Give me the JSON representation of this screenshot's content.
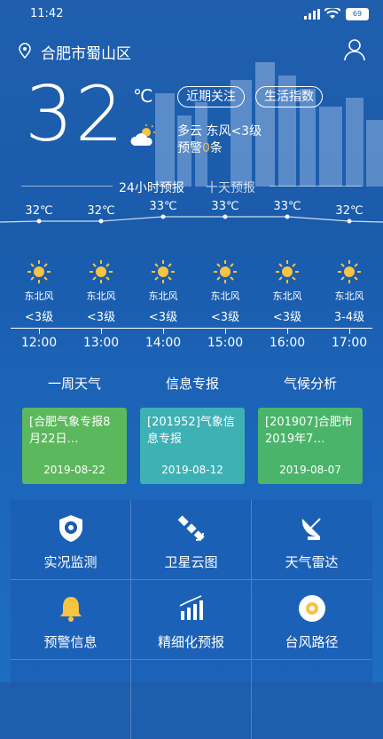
{
  "status_bar": {
    "time": "11:42",
    "battery": "69"
  },
  "header": {
    "location": "合肥市蜀山区"
  },
  "current": {
    "temperature": "32",
    "unit": "℃",
    "condition": "多云 东风<3级",
    "alert_label": "预警",
    "alert_count": "0",
    "alert_suffix": "条",
    "chips": [
      "近期关注",
      "生活指数"
    ]
  },
  "forecast_tabs": {
    "hourly": "24小时预报",
    "ten_day": "十天预报"
  },
  "hourly": [
    {
      "temp": "32℃",
      "wind": "东北风",
      "level": "<3级",
      "time": "12:00"
    },
    {
      "temp": "32℃",
      "wind": "东北风",
      "level": "<3级",
      "time": "13:00"
    },
    {
      "temp": "33℃",
      "wind": "东北风",
      "level": "<3级",
      "time": "14:00"
    },
    {
      "temp": "33℃",
      "wind": "东北风",
      "level": "<3级",
      "time": "15:00"
    },
    {
      "temp": "33℃",
      "wind": "东北风",
      "level": "<3级",
      "time": "16:00"
    },
    {
      "temp": "32℃",
      "wind": "东北风",
      "level": "3-4级",
      "time": "17:00"
    }
  ],
  "sections": {
    "titles": [
      "一周天气",
      "信息专报",
      "气候分析"
    ],
    "cards": [
      {
        "text": "[合肥气象专报8月22日…",
        "date": "2019-08-22"
      },
      {
        "text": "[201952]气象信息专报",
        "date": "2019-08-12"
      },
      {
        "text": "[201907]合肥市2019年7…",
        "date": "2019-08-07"
      }
    ]
  },
  "grid": [
    {
      "label": "实况监测",
      "icon": "shield-monitor-icon"
    },
    {
      "label": "卫星云图",
      "icon": "satellite-icon"
    },
    {
      "label": "天气雷达",
      "icon": "radar-dish-icon"
    },
    {
      "label": "预警信息",
      "icon": "bell-icon"
    },
    {
      "label": "精细化预报",
      "icon": "bar-chart-icon"
    },
    {
      "label": "台风路径",
      "icon": "typhoon-icon"
    }
  ],
  "colors": {
    "accent_yellow": "#f6b93b",
    "card_green": "#5cb85c",
    "card_teal": "#3eb1b5"
  }
}
